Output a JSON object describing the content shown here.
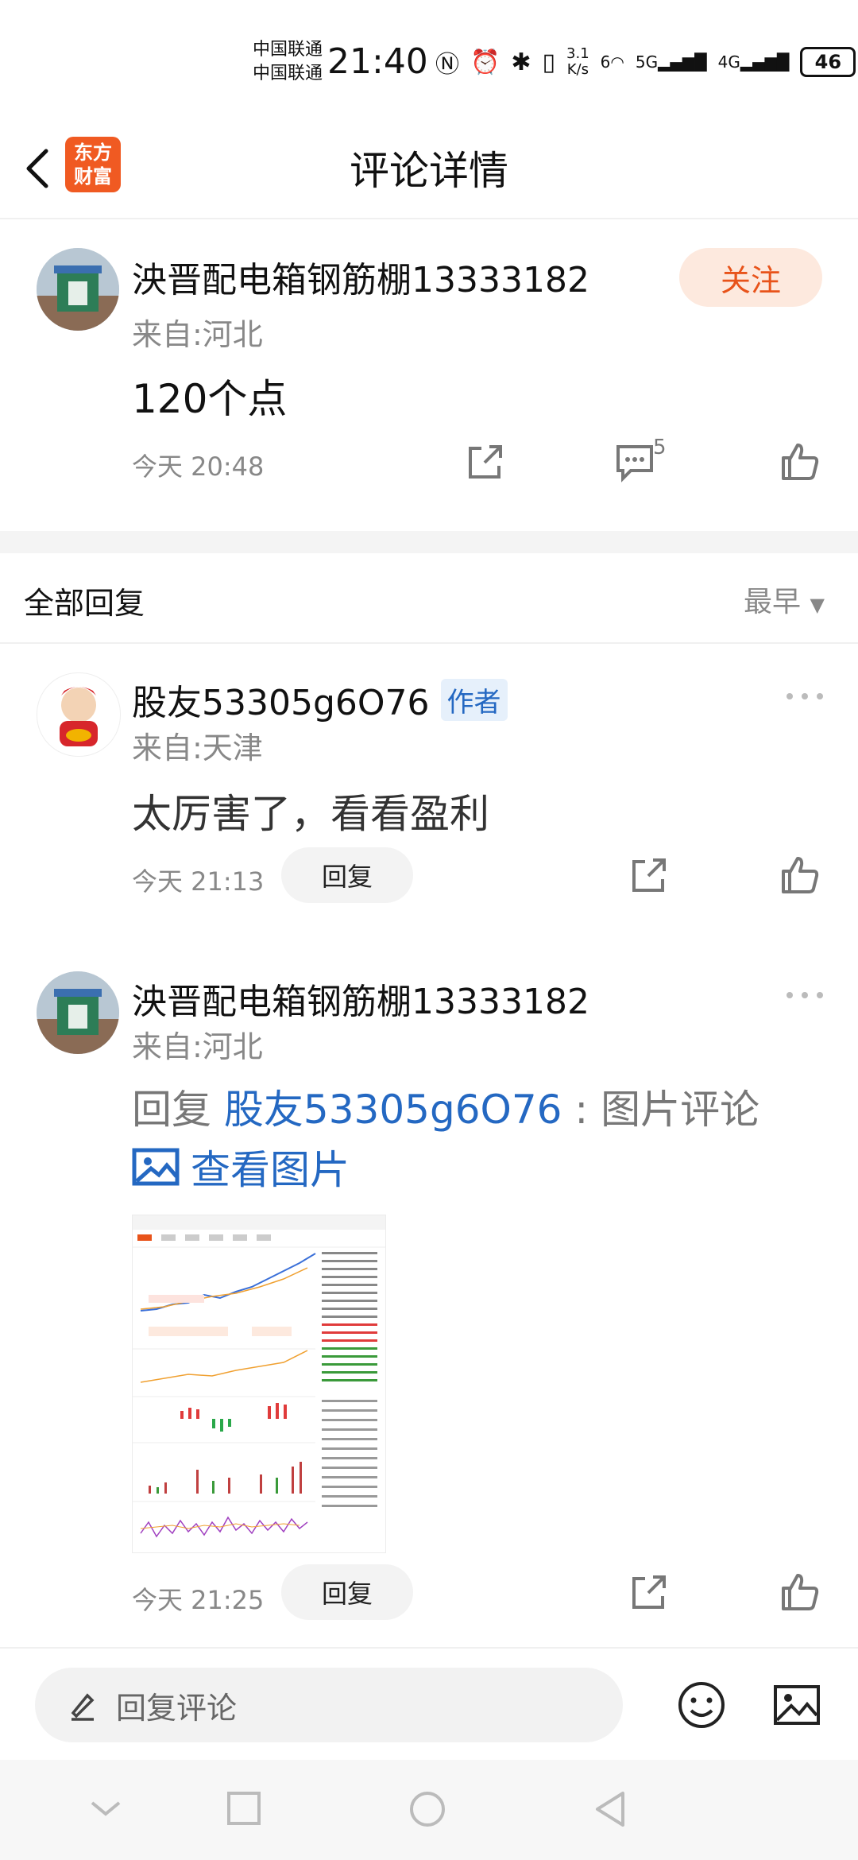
{
  "status_bar": {
    "carrier1": "中国联通",
    "carrier2": "中国联通",
    "time": "21:40",
    "net_speed_value": "3.1",
    "net_speed_unit": "K/s",
    "wifi_label": "6",
    "sig1": "5G",
    "sig2": "4G",
    "battery": "46"
  },
  "header": {
    "title": "评论详情",
    "logo_line1": "东方",
    "logo_line2": "财富"
  },
  "post": {
    "username": "泱晋配电箱钢筋棚13333182",
    "from": "来自:河北",
    "follow_label": "关注",
    "content": "120个点",
    "time": "今天 20:48",
    "comment_count": "5"
  },
  "replies_section": {
    "title": "全部回复",
    "sort": "最早"
  },
  "replies": [
    {
      "username": "股友53305g6O76",
      "tag": "作者",
      "from": "来自:天津",
      "content": "太厉害了，看看盈利",
      "time": "今天 21:13",
      "reply_label": "回复"
    },
    {
      "username": "泱晋配电箱钢筋棚13333182",
      "from": "来自:河北",
      "prefix": "回复",
      "mention": "股友53305g6O76",
      "suffix": " : 图片评论",
      "view_pic": "查看图片",
      "time": "今天 21:25",
      "reply_label": "回复"
    }
  ],
  "bottom_bar": {
    "placeholder": "回复评论"
  },
  "colors": {
    "accent": "#e8531a",
    "link": "#2468c2",
    "muted": "#888888"
  }
}
